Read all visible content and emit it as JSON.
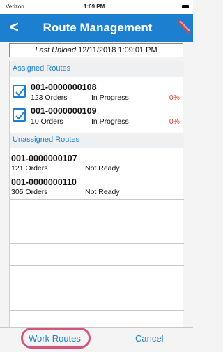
{
  "status_bar": {
    "carrier": "Verizon",
    "time": "1:09 PM"
  },
  "nav": {
    "back_label": "<",
    "title": "Route Management"
  },
  "last_unload": {
    "label": "Last Unload",
    "value": "12/11/2018 1:09:01 PM"
  },
  "assigned": {
    "header": "Assigned Routes",
    "routes": [
      {
        "id": "001-0000000108",
        "orders": "123 Orders",
        "status": "In Progress",
        "percent": "0%",
        "checked": true
      },
      {
        "id": "001-0000000109",
        "orders": "10 Orders",
        "status": "In Progress",
        "percent": "0%",
        "checked": true
      }
    ]
  },
  "unassigned": {
    "header": "Unassigned Routes",
    "routes": [
      {
        "id": "001-0000000107",
        "orders": "121 Orders",
        "status": "Not Ready"
      },
      {
        "id": "001-0000000110",
        "orders": "305 Orders",
        "status": "Not Ready"
      }
    ]
  },
  "bottom": {
    "work_routes_label": "Work Routes",
    "cancel_label": "Cancel"
  },
  "colors": {
    "accent": "#1c7fd0",
    "alert": "#e0413a",
    "highlight": "#d6537a"
  }
}
